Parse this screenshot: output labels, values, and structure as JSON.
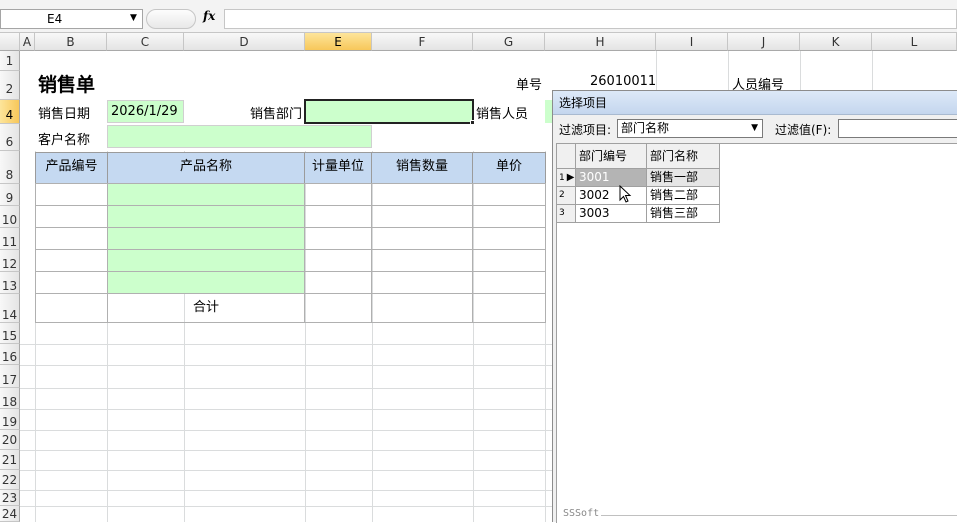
{
  "formula_bar": {
    "name_box": "E4",
    "fx": "fx",
    "value": ""
  },
  "columns": [
    "A",
    "B",
    "C",
    "D",
    "E",
    "F",
    "G",
    "H",
    "I",
    "J",
    "K",
    "L"
  ],
  "selected_column": "E",
  "rows": [
    "1",
    "2",
    "4",
    "6",
    "8",
    "9",
    "10",
    "11",
    "12",
    "13",
    "14",
    "15",
    "16",
    "17",
    "18",
    "19",
    "20",
    "21",
    "22",
    "23",
    "24"
  ],
  "selected_row": "4",
  "sheet": {
    "title": "销售单",
    "order_no_label": "单号",
    "order_no": "26010011",
    "staff_no_label": "人员编号",
    "date_label": "销售日期",
    "date_value": "2026/1/29",
    "dept_label": "销售部门",
    "dept_value": "",
    "sales_person_label": "销售人员",
    "customer_label": "客户名称",
    "customer_value": "",
    "table_headers": [
      "产品编号",
      "产品名称",
      "计量单位",
      "销售数量",
      "单价"
    ],
    "total_label": "合计"
  },
  "dialog": {
    "title": "选择项目",
    "filter_item_label": "过滤项目:",
    "filter_item_value": "部门名称",
    "filter_value_label": "过滤值(F):",
    "filter_value": "",
    "grid_headers": [
      "部门编号",
      "部门名称"
    ],
    "grid_rows": [
      {
        "num": "1",
        "code": "3001",
        "name": "销售一部"
      },
      {
        "num": "2",
        "code": "3002",
        "name": "销售二部"
      },
      {
        "num": "3",
        "code": "3003",
        "name": "销售三部"
      }
    ],
    "footer": "SSSoft"
  },
  "colors": {
    "input_fill": "#ccffcc",
    "header_fill": "#c5d9f1",
    "selection": "#f7c75a"
  }
}
